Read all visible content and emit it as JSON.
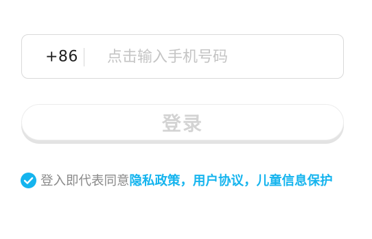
{
  "phone": {
    "country_code": "+86",
    "placeholder": "点击输入手机号码",
    "value": ""
  },
  "login": {
    "label": "登录"
  },
  "agreement": {
    "checked": true,
    "prefix": "登入即代表同意",
    "privacy_link": "隐私政策",
    "sep1": "，",
    "user_agreement_link": "用户协议",
    "sep2": "，",
    "children_privacy_link": "儿童信息保护"
  },
  "colors": {
    "accent": "#15b4ee",
    "check": "#15b4ee",
    "muted_text": "#8a8a8a",
    "disabled_button_text": "#d3d3d3"
  },
  "icons": {
    "checkbox": "check-circle-icon"
  }
}
